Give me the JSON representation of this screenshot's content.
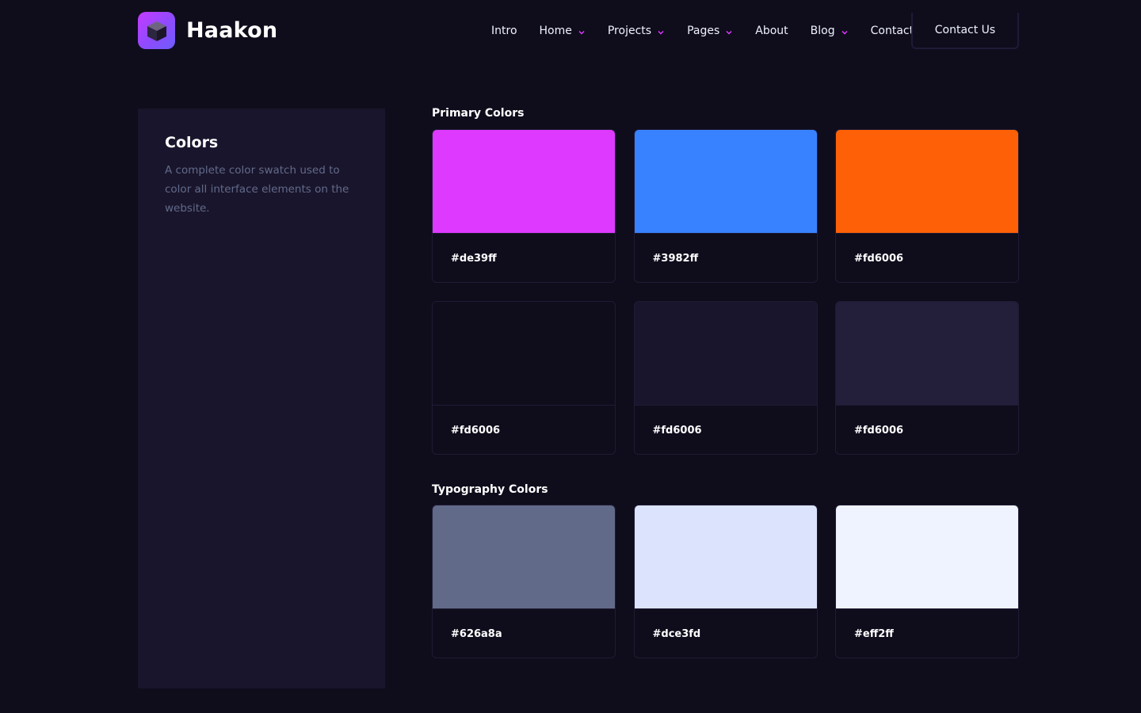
{
  "brand": {
    "name": "Haakon",
    "gradient": [
      "#c43bff",
      "#6d5dfc"
    ]
  },
  "nav": {
    "items": [
      {
        "label": "Intro",
        "has_dropdown": false
      },
      {
        "label": "Home",
        "has_dropdown": true
      },
      {
        "label": "Projects",
        "has_dropdown": true
      },
      {
        "label": "Pages",
        "has_dropdown": true
      },
      {
        "label": "About",
        "has_dropdown": false
      },
      {
        "label": "Blog",
        "has_dropdown": true
      },
      {
        "label": "Contact",
        "has_dropdown": false
      }
    ],
    "cta_label": "Contact Us",
    "chevron_color": "#de39ff"
  },
  "sidebar": {
    "title": "Colors",
    "description": "A complete color swatch used to color all interface elements on the website."
  },
  "primary": {
    "title": "Primary Colors",
    "swatches": [
      {
        "label": "#de39ff",
        "color": "#de39ff"
      },
      {
        "label": "#3982ff",
        "color": "#3982ff"
      },
      {
        "label": "#fd6006",
        "color": "#fd6006"
      },
      {
        "label": "#fd6006",
        "color": "#0f0d1c"
      },
      {
        "label": "#fd6006",
        "color": "#19152c"
      },
      {
        "label": "#fd6006",
        "color": "#231e3a"
      }
    ]
  },
  "typography": {
    "title": "Typography Colors",
    "swatches": [
      {
        "label": "#626a8a",
        "color": "#626a8a"
      },
      {
        "label": "#dce3fd",
        "color": "#dce3fd"
      },
      {
        "label": "#eff2ff",
        "color": "#eff2ff"
      }
    ]
  }
}
